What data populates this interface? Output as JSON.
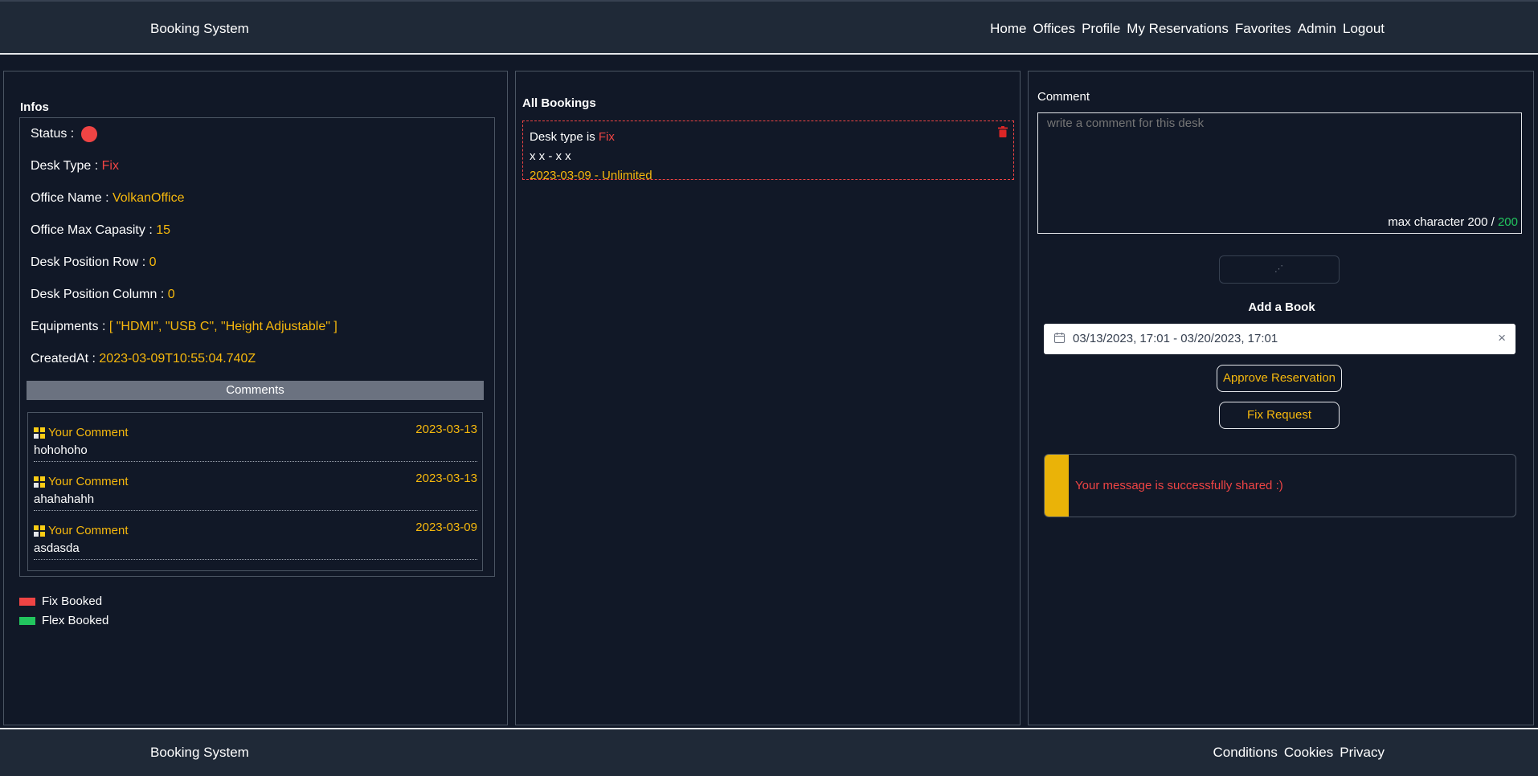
{
  "header": {
    "brand": "Booking System",
    "nav": [
      "Home",
      "Offices",
      "Profile",
      "My Reservations",
      "Favorites",
      "Admin",
      "Logout"
    ]
  },
  "infos": {
    "title": "Infos",
    "status_label": "Status :",
    "status_color": "#ef4444",
    "desk_type_label": "Desk Type :",
    "desk_type": "Fix",
    "office_name_label": "Office Name :",
    "office_name": "VolkanOffice",
    "max_capacity_label": "Office Max Capasity :",
    "max_capacity": "15",
    "row_label": "Desk Position Row :",
    "row": "0",
    "column_label": "Desk Position Column :",
    "column": "0",
    "equipments_label": "Equipments :",
    "equipments": "[ \"HDMI\", \"USB C\", \"Height Adjustable\" ]",
    "created_label": "CreatedAt :",
    "created": "2023-03-09T10:55:04.740Z"
  },
  "comments": {
    "header": "Comments",
    "items": [
      {
        "author": "Your Comment",
        "date": "2023-03-13",
        "text": "hohohoho"
      },
      {
        "author": "Your Comment",
        "date": "2023-03-13",
        "text": "ahahahahh"
      },
      {
        "author": "Your Comment",
        "date": "2023-03-09",
        "text": "asdasda"
      }
    ]
  },
  "legend": [
    {
      "label": "Fix Booked",
      "color": "#ef4444"
    },
    {
      "label": "Flex Booked",
      "color": "#22c55e"
    }
  ],
  "bookings": {
    "title": "All Bookings",
    "items": [
      {
        "type_prefix": "Desk type is",
        "type": "Fix",
        "position": "x x - x x",
        "range": "2023-03-09 - Unlimited"
      }
    ]
  },
  "comment_form": {
    "label": "Comment",
    "placeholder": "write a comment for this desk",
    "counter_prefix": "max character 200 /",
    "counter_value": "200"
  },
  "add_book": {
    "title": "Add a Book",
    "date_range": "03/13/2023, 17:01  -  03/20/2023, 17:01",
    "approve_label": "Approve Reservation",
    "fix_label": "Fix Request"
  },
  "toast": {
    "message": "Your message is successfully shared :)"
  },
  "footer": {
    "brand": "Booking System",
    "links": [
      "Conditions",
      "Cookies",
      "Privacy"
    ]
  }
}
